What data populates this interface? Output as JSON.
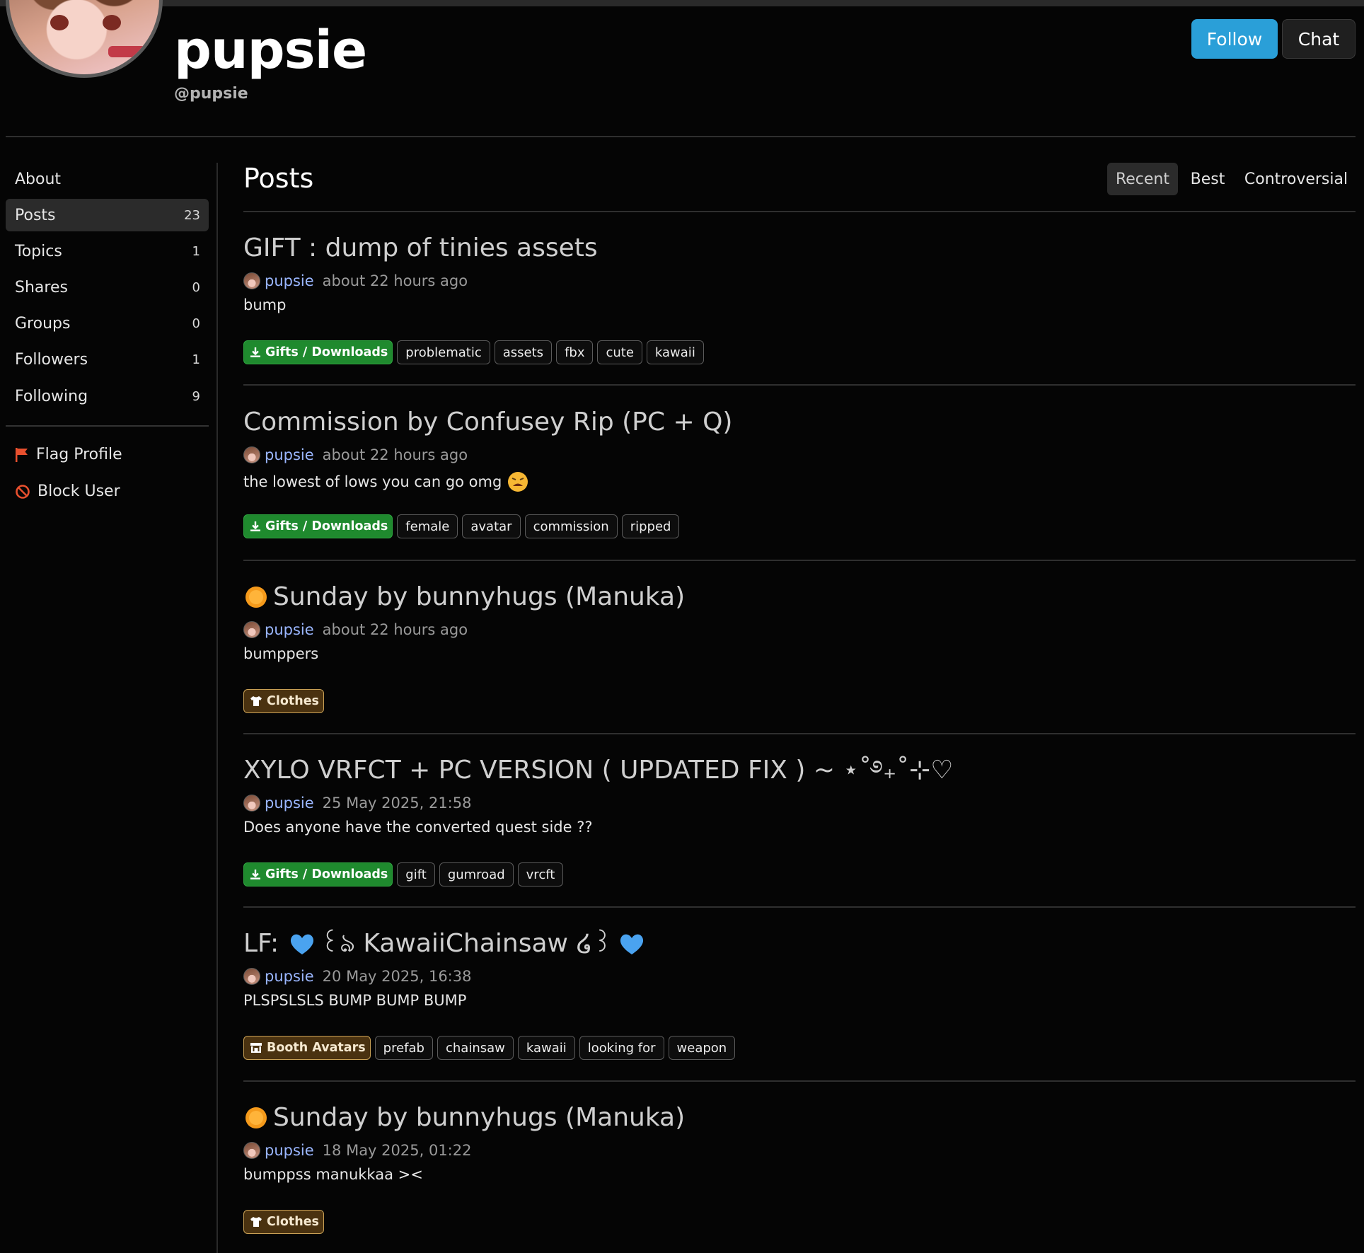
{
  "profile": {
    "display_name": "pupsie",
    "handle": "@pupsie",
    "follow_label": "Follow",
    "chat_label": "Chat"
  },
  "sidebar": {
    "items": [
      {
        "label": "About",
        "count": ""
      },
      {
        "label": "Posts",
        "count": "23"
      },
      {
        "label": "Topics",
        "count": "1"
      },
      {
        "label": "Shares",
        "count": "0"
      },
      {
        "label": "Groups",
        "count": "0"
      },
      {
        "label": "Followers",
        "count": "1"
      },
      {
        "label": "Following",
        "count": "9"
      }
    ],
    "actions": {
      "flag_label": "Flag Profile",
      "block_label": "Block User"
    }
  },
  "main": {
    "title": "Posts",
    "sort": {
      "recent": "Recent",
      "best": "Best",
      "controversial": "Controversial"
    },
    "posts": [
      {
        "title": "GIFT : dump of tinies assets",
        "author": "pupsie",
        "time": "about 22 hours ago",
        "snippet": "bump",
        "category": "Gifts / Downloads",
        "tags": [
          "problematic",
          "assets",
          "fbx",
          "cute",
          "kawaii"
        ]
      },
      {
        "title": "Commission by Confusey Rip (PC + Q)",
        "author": "pupsie",
        "time": "about 22 hours ago",
        "snippet": "the lowest of lows you can go omg",
        "category": "Gifts / Downloads",
        "tags": [
          "female",
          "avatar",
          "commission",
          "ripped"
        ]
      },
      {
        "title": "Sunday by bunnyhugs (Manuka)",
        "author": "pupsie",
        "time": "about 22 hours ago",
        "snippet": "bumppers",
        "category": "Clothes",
        "tags": []
      },
      {
        "title": "XYLO VRFCT + PC VERSION ( UPDATED FIX ) ~ ⋆˚࿔₊˚⊹♡",
        "author": "pupsie",
        "time": "25 May 2025, 21:58",
        "snippet": "Does anyone have the converted quest side ??",
        "category": "Gifts / Downloads",
        "tags": [
          "gift",
          "gumroad",
          "vrcft"
        ]
      },
      {
        "title_prefix": "LF:",
        "title": "꒰ঌ KawaiiChainsaw ໒꒱",
        "author": "pupsie",
        "time": "20 May 2025, 16:38",
        "snippet": "PLSPSLSLS BUMP BUMP BUMP",
        "category": "Booth Avatars",
        "tags": [
          "prefab",
          "chainsaw",
          "kawaii",
          "looking for",
          "weapon"
        ]
      },
      {
        "title": "Sunday by bunnyhugs (Manuka)",
        "author": "pupsie",
        "time": "18 May 2025, 01:22",
        "snippet": "bumppss manukkaa ><",
        "category": "Clothes",
        "tags": []
      }
    ]
  },
  "colors": {
    "accent_blue": "#2a9fd8",
    "author_link": "#9ab6ff",
    "category_green": "#1f8a2e",
    "category_brown": "#4a3210",
    "flag_icon": "#e8502e",
    "block_icon": "#e8502e"
  }
}
